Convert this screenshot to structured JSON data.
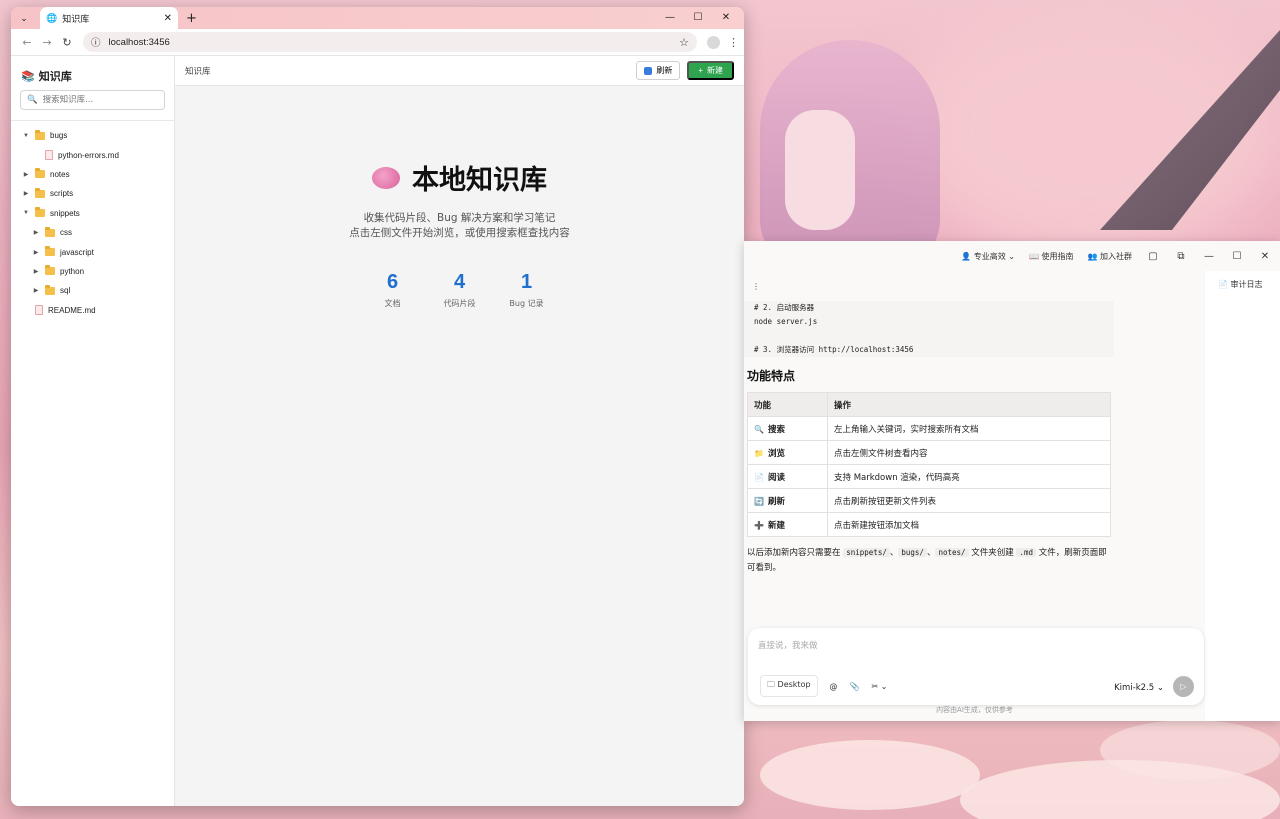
{
  "browser": {
    "tab_title": "知识库",
    "url": "localhost:3456",
    "window_controls": {
      "minimize": "—",
      "maximize": "☐",
      "close": "✕"
    }
  },
  "sidebar": {
    "title": "知识库",
    "search_placeholder": "搜索知识库...",
    "tree": [
      {
        "label": "bugs",
        "type": "folder",
        "expanded": true,
        "level": 0
      },
      {
        "label": "python-errors.md",
        "type": "file",
        "level": 1
      },
      {
        "label": "notes",
        "type": "folder",
        "expanded": false,
        "level": 0
      },
      {
        "label": "scripts",
        "type": "folder",
        "expanded": false,
        "level": 0
      },
      {
        "label": "snippets",
        "type": "folder",
        "expanded": true,
        "level": 0
      },
      {
        "label": "css",
        "type": "folder",
        "expanded": false,
        "level": 1
      },
      {
        "label": "javascript",
        "type": "folder",
        "expanded": false,
        "level": 1
      },
      {
        "label": "python",
        "type": "folder",
        "expanded": false,
        "level": 1
      },
      {
        "label": "sql",
        "type": "folder",
        "expanded": false,
        "level": 1
      },
      {
        "label": "README.md",
        "type": "file",
        "level": 0
      }
    ]
  },
  "toolbar": {
    "breadcrumb": "知识库",
    "refresh_label": "刷新",
    "new_label": "新建"
  },
  "welcome": {
    "title": "本地知识库",
    "subtitle_1": "收集代码片段、Bug 解决方案和学习笔记",
    "subtitle_2": "点击左侧文件开始浏览，或使用搜索框查找内容",
    "stats": [
      {
        "num": "6",
        "label": "文档"
      },
      {
        "num": "4",
        "label": "代码片段"
      },
      {
        "num": "1",
        "label": "Bug 记录"
      }
    ]
  },
  "kimi": {
    "mode": "专业高效",
    "guide": "使用指南",
    "community": "加入社群",
    "audit_log": "审计日志",
    "code_lines": [
      "# 2. 启动服务器",
      "node server.js",
      "",
      "# 3. 浏览器访问 http://localhost:3456"
    ],
    "heading": "功能特点",
    "table_headers": [
      "功能",
      "操作"
    ],
    "table_rows": [
      {
        "icon": "🔍",
        "feature": "搜索",
        "action": "左上角输入关键词，实时搜索所有文档"
      },
      {
        "icon": "📁",
        "feature": "浏览",
        "action": "点击左侧文件树查看内容"
      },
      {
        "icon": "📄",
        "feature": "阅读",
        "action": "支持 Markdown 渲染，代码高亮"
      },
      {
        "icon": "🔄",
        "feature": "刷新",
        "action": "点击刷新按钮更新文件列表"
      },
      {
        "icon": "➕",
        "feature": "新建",
        "action": "点击新建按钮添加文档"
      }
    ],
    "para_pre": "以后添加新内容只需要在",
    "para_code_1": "snippets/",
    "para_sep_1": "、",
    "para_code_2": "bugs/",
    "para_sep_2": "、",
    "para_code_3": "notes/",
    "para_mid": "文件夹创建",
    "para_code_4": ".md",
    "para_post": "文件，刷新页面即可看到。",
    "input_placeholder": "直接说，我来做",
    "desktop_chip": "Desktop",
    "at_label": "@",
    "model": "Kimi-k2.5",
    "footer": "内容由AI生成，仅供参考"
  }
}
